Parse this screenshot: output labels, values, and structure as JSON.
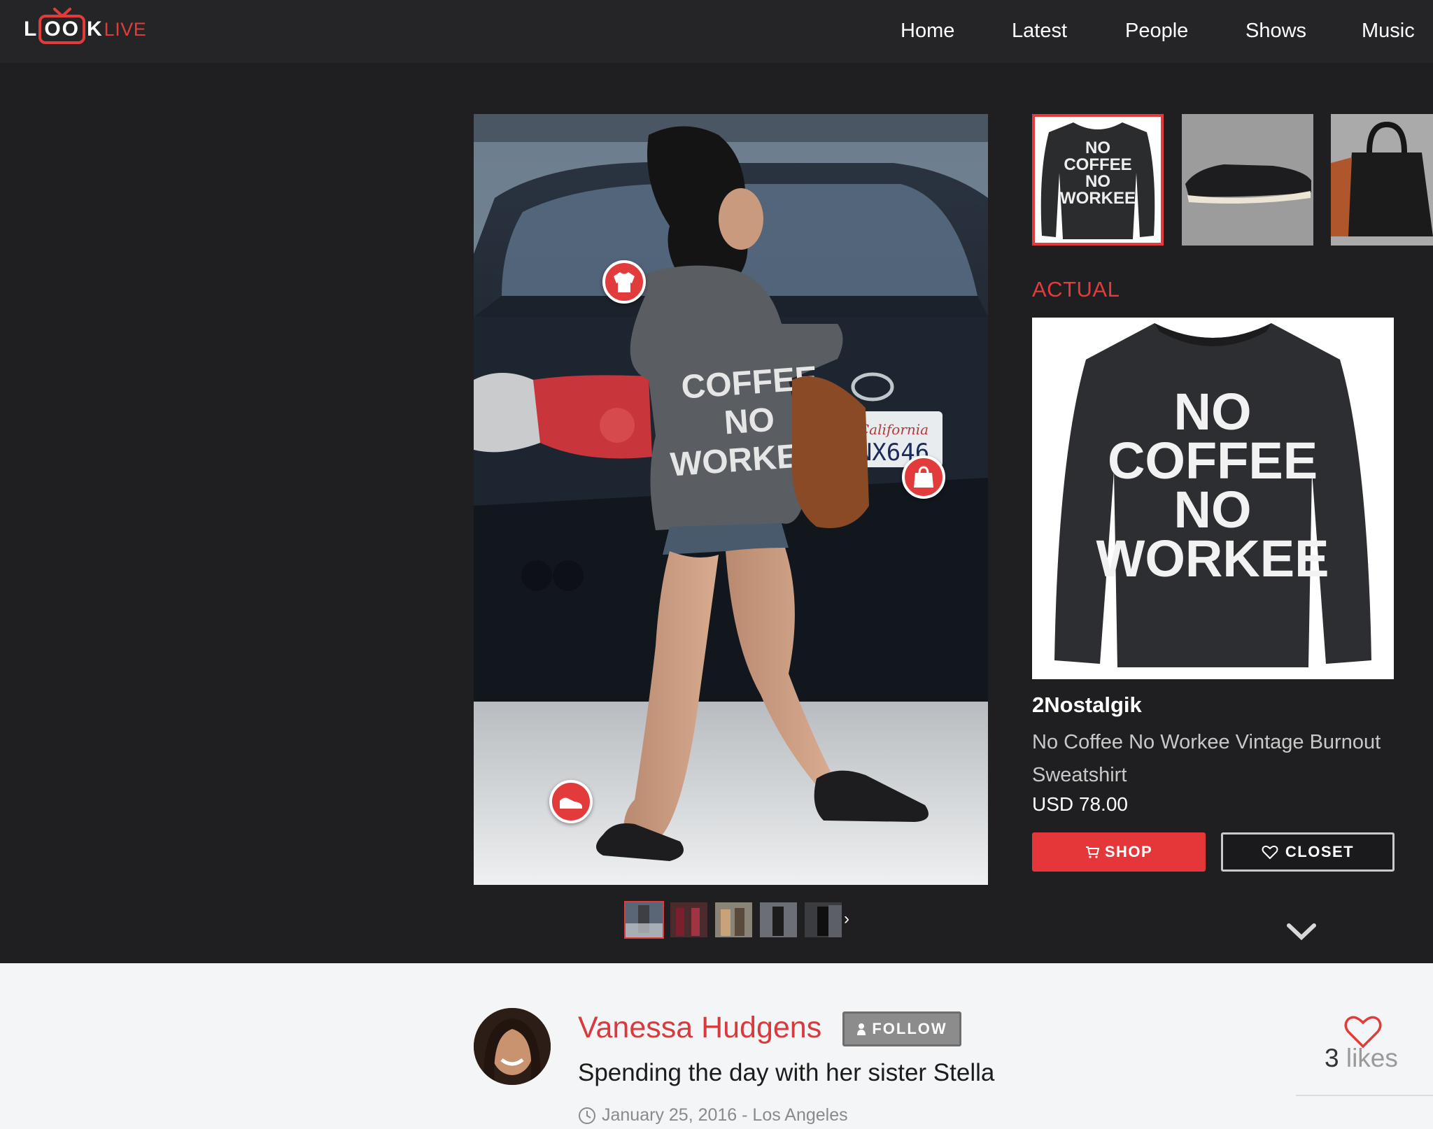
{
  "header": {
    "logo": {
      "l": "L",
      "oo": "OO",
      "k": "K",
      "live": "LIVE"
    },
    "nav": [
      "Home",
      "Latest",
      "People",
      "Shows",
      "Music"
    ]
  },
  "colors": {
    "accent": "#e23b3b",
    "header_bg": "#252527",
    "page_bg": "#1f1f21",
    "bottom_bg": "#f4f5f6"
  },
  "hotspots": [
    {
      "icon": "sweatshirt-icon"
    },
    {
      "icon": "bag-icon"
    },
    {
      "icon": "shoe-icon"
    }
  ],
  "photo": {
    "sweatshirt_text": [
      "COFFEE",
      "NO",
      "WORKEE"
    ],
    "plate_text": "NX646",
    "plate_state": "California"
  },
  "product": {
    "thumb_text": [
      "NO",
      "COFFEE",
      "NO",
      "WORKEE"
    ],
    "actual_label": "ACTUAL",
    "brand": "2Nostalgik",
    "name": "No Coffee No Workee Vintage Burnout Sweatshirt",
    "price": "USD 78.00",
    "image_text": [
      "NO",
      "COFFEE",
      "NO",
      "WORKEE"
    ],
    "shop_label": "SHOP",
    "closet_label": "CLOSET"
  },
  "post": {
    "person": "Vanessa Hudgens",
    "follow_label": "FOLLOW",
    "caption": "Spending the day with her sister Stella",
    "meta": "January 25, 2016 - Los Angeles",
    "likes_count": "3",
    "likes_word": "likes"
  }
}
